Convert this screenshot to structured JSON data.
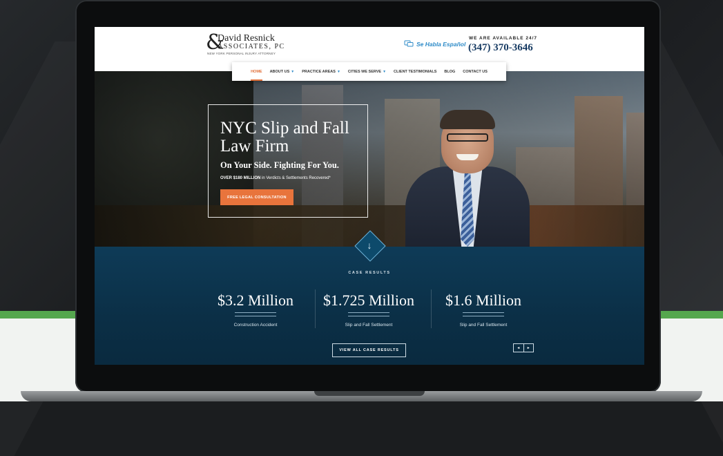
{
  "header": {
    "logo_amp": "&",
    "logo_line1": "David Resnick",
    "logo_line2": "ASSOCIATES, PC",
    "logo_tagline": "NEW YORK PERSONAL INJURY ATTORNEY",
    "espanol": "Se Habla Español",
    "available": "WE ARE AVAILABLE 24/7",
    "phone": "(347) 370-3646"
  },
  "nav": {
    "items": [
      {
        "label": "HOME",
        "active": true,
        "has_caret": false
      },
      {
        "label": "ABOUT US",
        "active": false,
        "has_caret": true
      },
      {
        "label": "PRACTICE AREAS",
        "active": false,
        "has_caret": true
      },
      {
        "label": "CITIES WE SERVE",
        "active": false,
        "has_caret": true
      },
      {
        "label": "CLIENT TESTIMONIALS",
        "active": false,
        "has_caret": false
      },
      {
        "label": "BLOG",
        "active": false,
        "has_caret": false
      },
      {
        "label": "CONTACT US",
        "active": false,
        "has_caret": false
      }
    ]
  },
  "hero": {
    "title": "NYC Slip and Fall Law Firm",
    "subtitle": "On Your Side. Fighting For You.",
    "stat_bold": "OVER $180 MILLION",
    "stat_rest": " in Verdicts & Settlements Recovered*",
    "cta": "FREE LEGAL CONSULTATION"
  },
  "results": {
    "label": "CASE RESULTS",
    "items": [
      {
        "amount": "$3.2 Million",
        "type": "Construction Accident"
      },
      {
        "amount": "$1.725 Million",
        "type": "Slip and Fall Settlement"
      },
      {
        "amount": "$1.6 Million",
        "type": "Slip and Fall Settlement"
      }
    ],
    "view_all": "VIEW ALL CASE RESULTS",
    "prev": "◂",
    "next": "▸"
  },
  "colors": {
    "accent": "#e8743c",
    "navy": "#0b2f46",
    "phone_blue": "#173b63",
    "link_blue": "#2e8bc8",
    "green_band": "#55a74e"
  }
}
